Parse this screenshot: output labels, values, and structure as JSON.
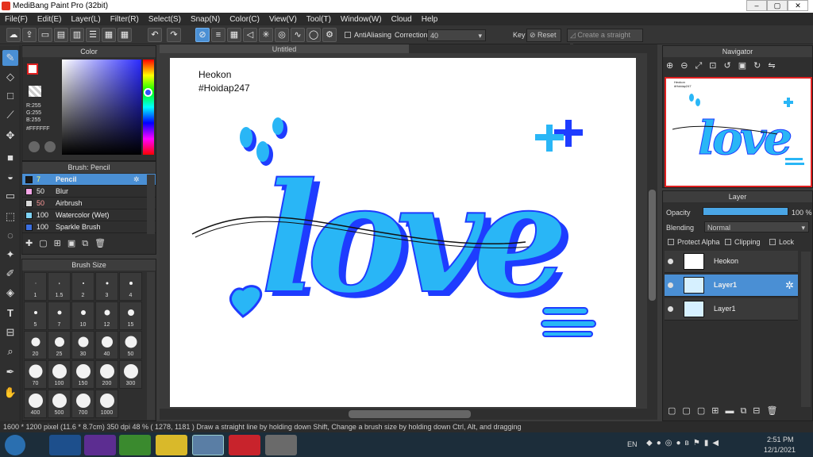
{
  "window": {
    "title": "MediBang Paint Pro (32bit)",
    "controls": [
      "–",
      "▢",
      "✕"
    ]
  },
  "menu": [
    "File(F)",
    "Edit(E)",
    "Layer(L)",
    "Filter(R)",
    "Select(S)",
    "Snap(N)",
    "Color(C)",
    "View(V)",
    "Tool(T)",
    "Window(W)",
    "Cloud",
    "Help"
  ],
  "toolbar": {
    "antialias_label": "AntiAliasing",
    "correction_label": "Correction",
    "correction_value": "40",
    "key_label": "Key",
    "reset_label": "Reset",
    "straight_line_label": "Create a straight line"
  },
  "color_panel": {
    "title": "Color",
    "r": "R:255",
    "g": "G:255",
    "b": "B:255",
    "hex": "#FFFFFF"
  },
  "brush_panel": {
    "title": "Brush: Pencil",
    "items": [
      {
        "size": "7",
        "name": "Pencil",
        "color": "#1a1a1a"
      },
      {
        "size": "50",
        "name": "Blur",
        "color": "#f4a6e6"
      },
      {
        "size": "50",
        "name": "Airbrush",
        "color": "#d9d9d9"
      },
      {
        "size": "100",
        "name": "Watercolor (Wet)",
        "color": "#7fd3f5"
      },
      {
        "size": "100",
        "name": "Sparkle Brush",
        "color": "#3b6fe0"
      }
    ]
  },
  "brush_size_panel": {
    "title": "Brush Size",
    "sizes": [
      "1",
      "1.5",
      "2",
      "3",
      "4",
      "5",
      "7",
      "10",
      "12",
      "15",
      "20",
      "25",
      "30",
      "40",
      "50",
      "70",
      "100",
      "150",
      "200",
      "300",
      "400",
      "500",
      "700",
      "1000"
    ]
  },
  "canvas": {
    "tab": "Untitled",
    "text_line1": "Heokon",
    "text_line2": "#Hoidap247",
    "word": "love"
  },
  "navigator": {
    "title": "Navigator"
  },
  "layer_panel": {
    "title": "Layer",
    "opacity_label": "Opacity",
    "opacity_value": "100 %",
    "opacity_fraction": 1.0,
    "blending_label": "Blending",
    "blending_value": "Normal",
    "protect_alpha": "Protect Alpha",
    "clipping": "Clipping",
    "lock": "Lock",
    "layers": [
      {
        "name": "Heokon"
      },
      {
        "name": "Layer1"
      },
      {
        "name": "Layer1"
      }
    ]
  },
  "status": {
    "text": "1600 * 1200 pixel   (11.6 * 8.7cm)   350 dpi   48 %   ( 1278, 1181 )   Draw a straight line by holding down Shift, Change a brush size by holding down Ctrl, Alt, and dragging"
  },
  "taskbar": {
    "lang": "EN",
    "time": "2:51 PM",
    "date": "12/1/2021"
  },
  "colors": {
    "accent": "#4a8fd4",
    "love_fill": "#29b6f6",
    "love_shadow": "#1e3cff"
  }
}
